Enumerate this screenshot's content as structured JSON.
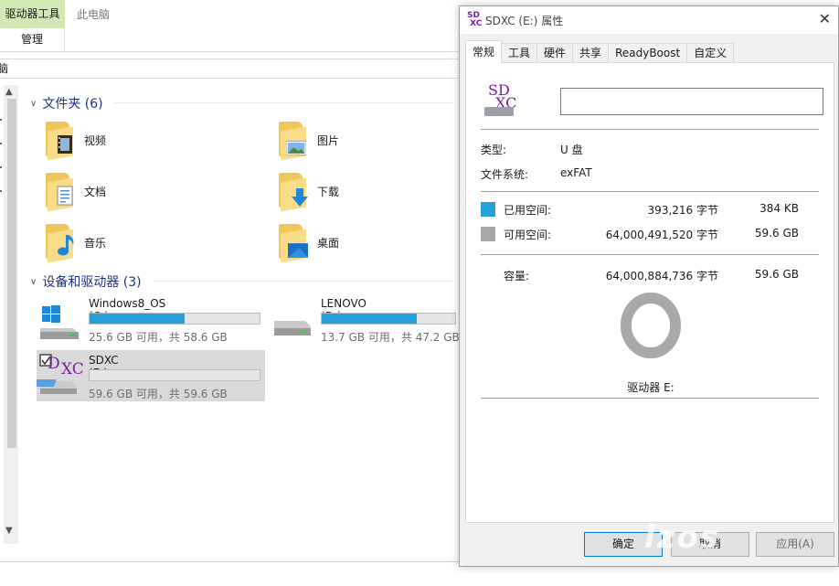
{
  "explorer": {
    "ribbon": {
      "active_tab": "驱动器工具",
      "window_title": "此电脑",
      "sub_tab": "管理"
    },
    "address": "脑",
    "folders_header": "文件夹 (6)",
    "folders": [
      {
        "label": "视频",
        "icon": "video-folder-icon"
      },
      {
        "label": "图片",
        "icon": "pictures-folder-icon"
      },
      {
        "label": "文档",
        "icon": "documents-folder-icon"
      },
      {
        "label": "下载",
        "icon": "downloads-folder-icon"
      },
      {
        "label": "音乐",
        "icon": "music-folder-icon"
      },
      {
        "label": "桌面",
        "icon": "desktop-folder-icon"
      }
    ],
    "devices_header": "设备和驱动器 (3)",
    "drives": [
      {
        "name": "Windows8_OS (C:)",
        "stats": "25.6 GB 可用，共 58.6 GB",
        "used_fraction": 0.56
      },
      {
        "name": "LENOVO (D:)",
        "stats": "13.7 GB 可用，共 47.2 GB",
        "used_fraction": 0.71
      },
      {
        "name": "SDXC (E:)",
        "stats": "59.6 GB 可用，共 59.6 GB",
        "used_fraction": 0.0,
        "selected": true
      }
    ]
  },
  "dialog": {
    "title": "SDXC (E:) 属性",
    "tabs": [
      "常规",
      "工具",
      "硬件",
      "共享",
      "ReadyBoost",
      "自定义"
    ],
    "active_tab": "常规",
    "drive_label_value": "",
    "type_label": "类型:",
    "type_value": "U 盘",
    "fs_label": "文件系统:",
    "fs_value": "exFAT",
    "used_label": "已用空间:",
    "used_bytes": "393,216 字节",
    "used_short": "384 KB",
    "free_label": "可用空间:",
    "free_bytes": "64,000,491,520 字节",
    "free_short": "59.6 GB",
    "capacity_label": "容量:",
    "capacity_bytes": "64,000,884,736 字节",
    "capacity_short": "59.6 GB",
    "drive_caption": "驱动器 E:",
    "buttons": {
      "ok": "确定",
      "cancel": "取消",
      "apply": "应用(A)"
    },
    "colors": {
      "used": "#26a0da",
      "free": "#a8a8a8"
    }
  },
  "watermark": "lzos"
}
